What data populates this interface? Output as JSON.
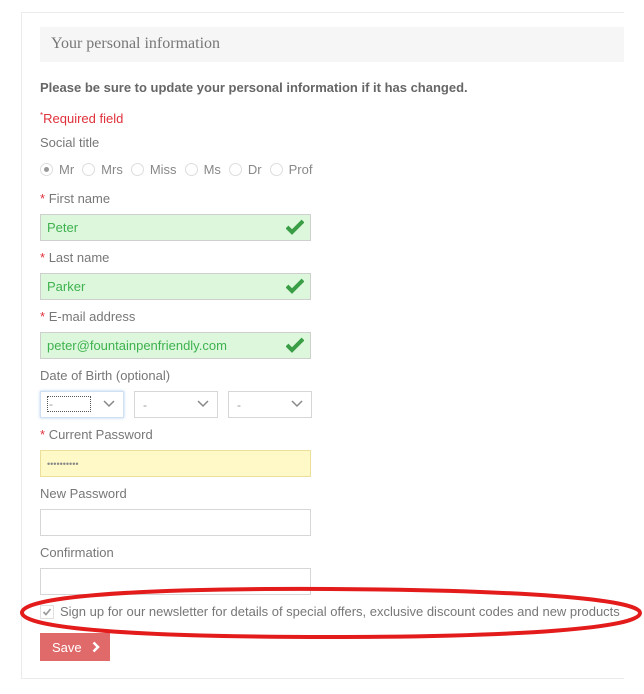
{
  "section": {
    "title": "Your personal information",
    "intro": "Please be sure to update your personal information if it has changed.",
    "required_marker": "*",
    "required_note": "Required field"
  },
  "social_title": {
    "label": "Social title",
    "options": [
      {
        "label": "Mr",
        "checked": true
      },
      {
        "label": "Mrs",
        "checked": false
      },
      {
        "label": "Miss",
        "checked": false
      },
      {
        "label": "Ms",
        "checked": false
      },
      {
        "label": "Dr",
        "checked": false
      },
      {
        "label": "Prof",
        "checked": false
      }
    ]
  },
  "fields": {
    "first_name": {
      "label": "First name",
      "required": "*",
      "value": "Peter",
      "status": "valid"
    },
    "last_name": {
      "label": "Last name",
      "required": "*",
      "value": "Parker",
      "status": "valid"
    },
    "email": {
      "label": "E-mail address",
      "required": "*",
      "value": "peter@fountainpenfriendly.com",
      "status": "valid"
    },
    "dob": {
      "label": "Date of Birth (optional)",
      "day": "-",
      "month": "-",
      "year": "-"
    },
    "current_password": {
      "label": "Current Password",
      "required": "*",
      "value": "••••••••••"
    },
    "new_password": {
      "label": "New Password",
      "value": ""
    },
    "confirmation": {
      "label": "Confirmation",
      "value": ""
    }
  },
  "newsletter": {
    "checked": true,
    "label": "Sign up for our newsletter for details of special offers, exclusive discount codes and new products"
  },
  "save_button": {
    "label": "Save"
  },
  "colors": {
    "required": "#e0303a",
    "valid_bg": "#dcf7dc",
    "valid_text": "#3fb24f",
    "warn_bg": "#fef9c7",
    "button": "#e06a6a",
    "annotation": "#e31b1b"
  }
}
